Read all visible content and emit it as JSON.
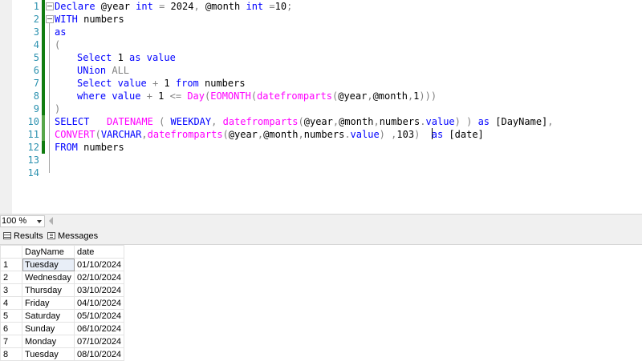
{
  "editor": {
    "lines": [
      {
        "num": "1"
      },
      {
        "num": "2"
      },
      {
        "num": "3"
      },
      {
        "num": "4"
      },
      {
        "num": "5"
      },
      {
        "num": "6"
      },
      {
        "num": "7"
      },
      {
        "num": "8"
      },
      {
        "num": "9"
      },
      {
        "num": "10"
      },
      {
        "num": "11"
      },
      {
        "num": "12"
      },
      {
        "num": "13"
      },
      {
        "num": "14"
      }
    ],
    "tokens": {
      "l1": {
        "k1": "Declare",
        "t1": " @year ",
        "k2": "int",
        "o1": " = ",
        "t2": "2024",
        "o2": ",",
        "t3": " @month ",
        "k3": "int",
        "o3": " =",
        "t4": "10",
        "o4": ";"
      },
      "l2": {
        "k1": "WITH",
        "t1": " numbers"
      },
      "l3": {
        "k1": "as"
      },
      "l4": {
        "o1": "("
      },
      "l5": {
        "k1": "Select",
        "t1": " 1 ",
        "k2": "as",
        "t2": " ",
        "k3": "value"
      },
      "l6": {
        "k1": "UNion",
        "t1": " ",
        "o1": "ALL"
      },
      "l7": {
        "k1": "Select",
        "t1": " ",
        "k2": "value",
        "t2": " ",
        "o1": "+",
        "t3": " 1 ",
        "k3": "from",
        "t4": " numbers"
      },
      "l8": {
        "k1": "where",
        "t1": " ",
        "k2": "value",
        "t2": " ",
        "o1": "+",
        "t3": " 1 ",
        "o2": "<=",
        "t4": " ",
        "f1": "Day",
        "o3": "(",
        "f2": "EOMONTH",
        "o4": "(",
        "f3": "datefromparts",
        "o5": "(",
        "t5": "@year",
        "o6": ",",
        "t6": "@month",
        "o7": ",",
        "t7": "1",
        "o8": ")))"
      },
      "l9": {
        "o1": ")"
      },
      "l10": {
        "k1": "SELECT",
        "t1": "   ",
        "f1": "DATENAME",
        "t2": " ",
        "o1": "(",
        "t3": " ",
        "k2": "WEEKDAY",
        "o2": ",",
        "t4": " ",
        "f2": "datefromparts",
        "o3": "(",
        "t5": "@year",
        "o4": ",",
        "t6": "@month",
        "o5": ",",
        "t7": "numbers",
        "o6": ".",
        "k3": "value",
        "o7": ")",
        "t8": " ",
        "o8": ")",
        "t9": " ",
        "k4": "as",
        "t10": " [DayName]",
        "o9": ","
      },
      "l11": {
        "f1": "CONVERT",
        "o1": "(",
        "k1": "VARCHAR",
        "o2": ",",
        "f2": "datefromparts",
        "o3": "(",
        "t1": "@year",
        "o4": ",",
        "t2": "@month",
        "o5": ",",
        "t3": "numbers",
        "o6": ".",
        "k2": "value",
        "o7": ")",
        "t4": " ",
        "o8": ",",
        "t5": "103",
        "o9": ")",
        "t6": "  ",
        "k3": "as",
        "t7": " [date]"
      },
      "l12": {
        "k1": "FROM",
        "t1": " numbers"
      }
    }
  },
  "zoom": {
    "value": "100 %"
  },
  "tabs": {
    "results": "Results",
    "messages": "Messages"
  },
  "grid": {
    "columns": [
      "DayName",
      "date"
    ],
    "rows": [
      {
        "n": "1",
        "day": "Tuesday",
        "date": "01/10/2024"
      },
      {
        "n": "2",
        "day": "Wednesday",
        "date": "02/10/2024"
      },
      {
        "n": "3",
        "day": "Thursday",
        "date": "03/10/2024"
      },
      {
        "n": "4",
        "day": "Friday",
        "date": "04/10/2024"
      },
      {
        "n": "5",
        "day": "Saturday",
        "date": "05/10/2024"
      },
      {
        "n": "6",
        "day": "Sunday",
        "date": "06/10/2024"
      },
      {
        "n": "7",
        "day": "Monday",
        "date": "07/10/2024"
      },
      {
        "n": "8",
        "day": "Tuesday",
        "date": "08/10/2024"
      }
    ]
  },
  "colors": {
    "keyword": "#0000ff",
    "function": "#ff00ff",
    "operator": "#808080",
    "line_number": "#2b91af",
    "change_bar": "#107c10"
  }
}
